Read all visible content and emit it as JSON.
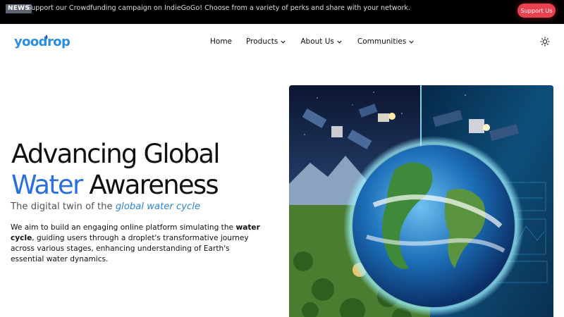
{
  "announcement": {
    "badge": "NEWS",
    "text": "Support our Crowdfunding campaign on IndieGoGo! Choose from a variety of perks and share with your network.",
    "support_button": "Support Us"
  },
  "header": {
    "logo_text": "yoodrop",
    "nav": {
      "home": "Home",
      "products": "Products",
      "about": "About Us",
      "communities": "Communities"
    }
  },
  "hero": {
    "title_line1": "Advancing Global",
    "title_accent": "Water",
    "title_rest": " Awareness",
    "subtitle_prefix": "The digital twin of the ",
    "subtitle_emphasis": "global water cycle",
    "desc_prefix": "We aim to build an engaging online platform simulating the ",
    "desc_bold": "water cycle",
    "desc_suffix": ", guiding users through a droplet's transformative journey across various stages, enhancing understanding of Earth's essential water dynamics."
  },
  "colors": {
    "accent_blue": "#2a6fe0",
    "support_red": "#e8414f",
    "topbar_bg": "#000000"
  }
}
